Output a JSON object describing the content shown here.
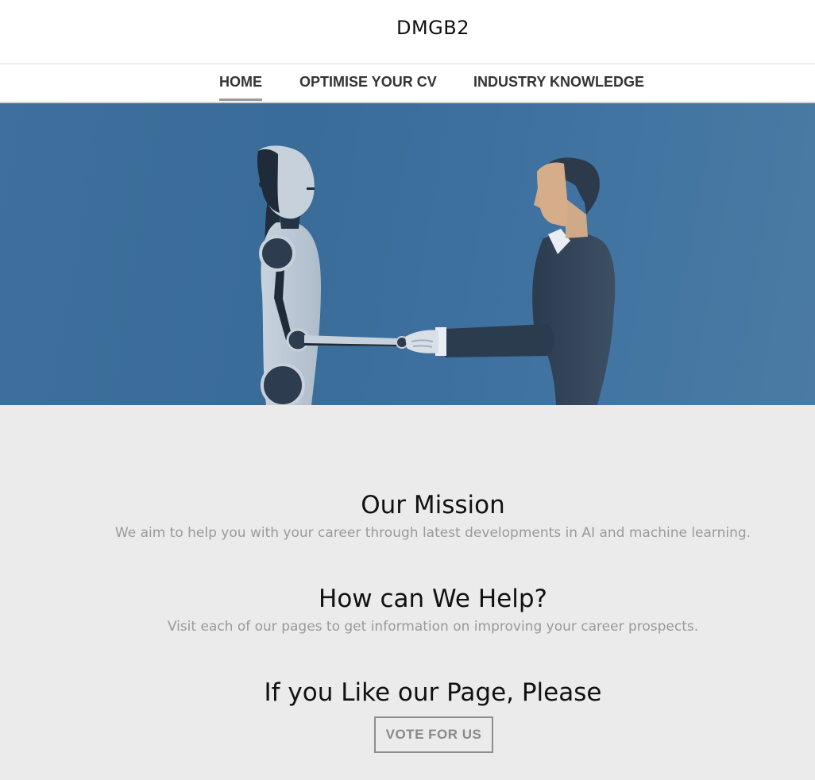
{
  "header": {
    "site_title": "DMGB2"
  },
  "nav": {
    "items": [
      {
        "label": "HOME",
        "active": true
      },
      {
        "label": "OPTIMISE YOUR CV",
        "active": false
      },
      {
        "label": "INDUSTRY KNOWLEDGE",
        "active": false
      }
    ]
  },
  "hero": {
    "image": "robot-human-handshake-illustration",
    "background_color": "#3c6e9c"
  },
  "sections": [
    {
      "heading": "Our Mission",
      "text": "We aim to help you with your career through latest developments in AI and machine learning."
    },
    {
      "heading": "How can We Help?",
      "text": "Visit each of our pages to get information on improving your career prospects."
    },
    {
      "heading": "If you Like our Page, Please"
    }
  ],
  "vote_button": {
    "label": "VOTE FOR US"
  }
}
